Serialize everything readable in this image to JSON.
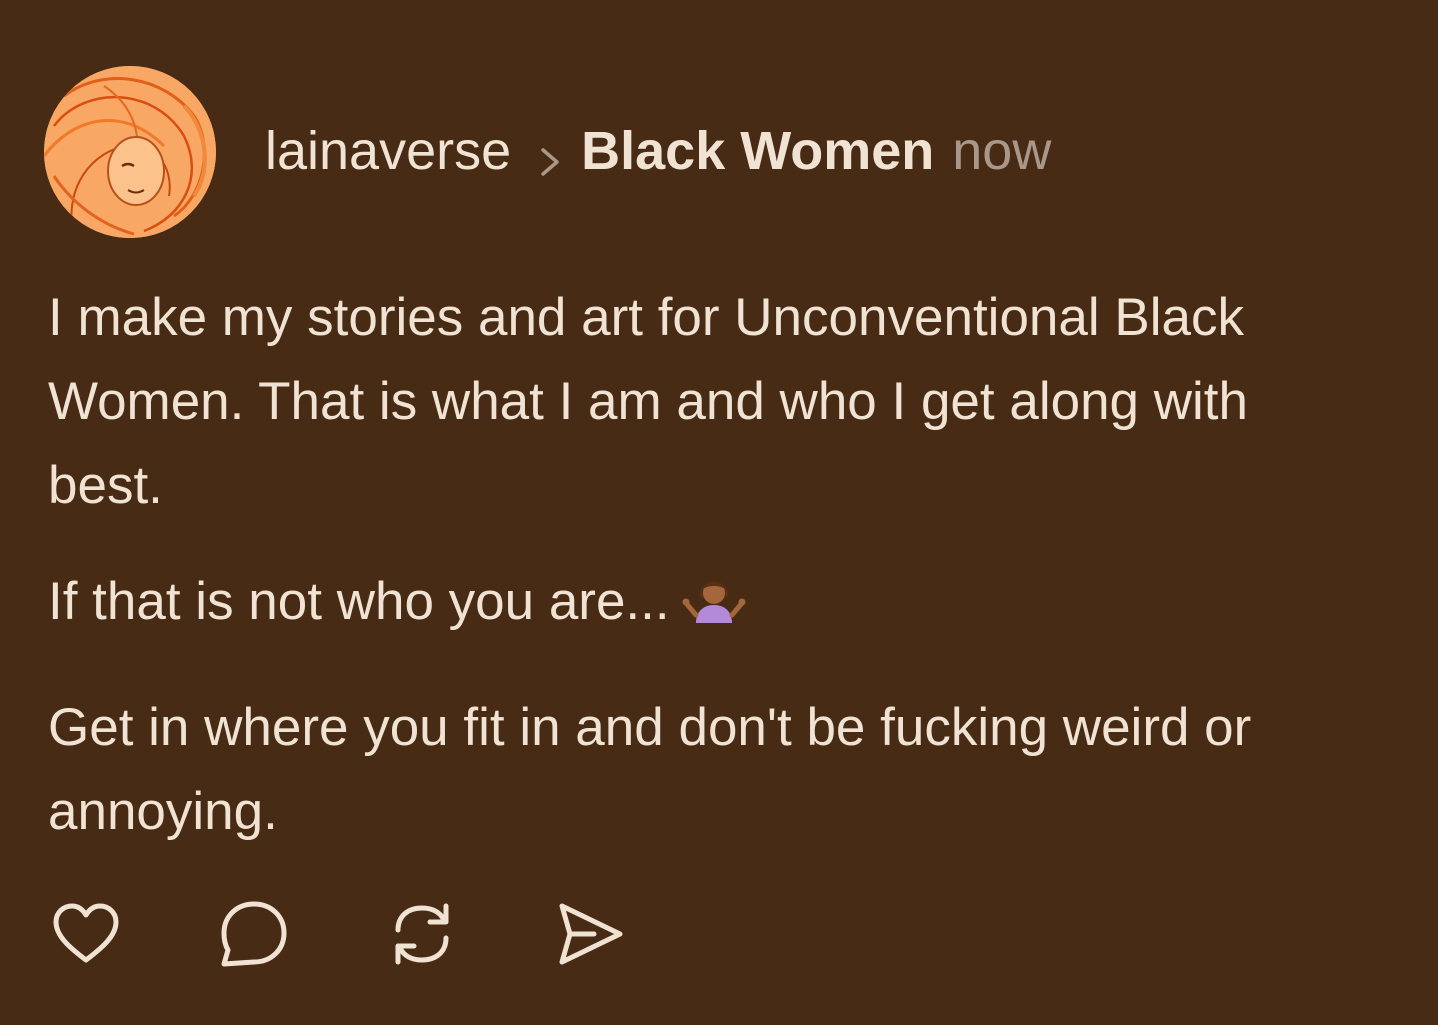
{
  "post": {
    "username": "lainaverse",
    "community": "Black Women",
    "timestamp": "now",
    "paragraphs": [
      "I make my stories and art for Unconventional Black Women. That is what I am and who I get along with best.",
      "If that is not who you are...",
      "Get in where you fit in and don't be fucking weird or annoying."
    ],
    "emoji": "person-shrugging-emoji"
  },
  "actions": {
    "like": "heart-icon",
    "comment": "comment-icon",
    "repost": "repost-icon",
    "share": "share-icon"
  },
  "colors": {
    "background": "#472b15",
    "text": "#f1e3d3",
    "muted": "#a9988a",
    "avatar": "#f7a35c"
  }
}
